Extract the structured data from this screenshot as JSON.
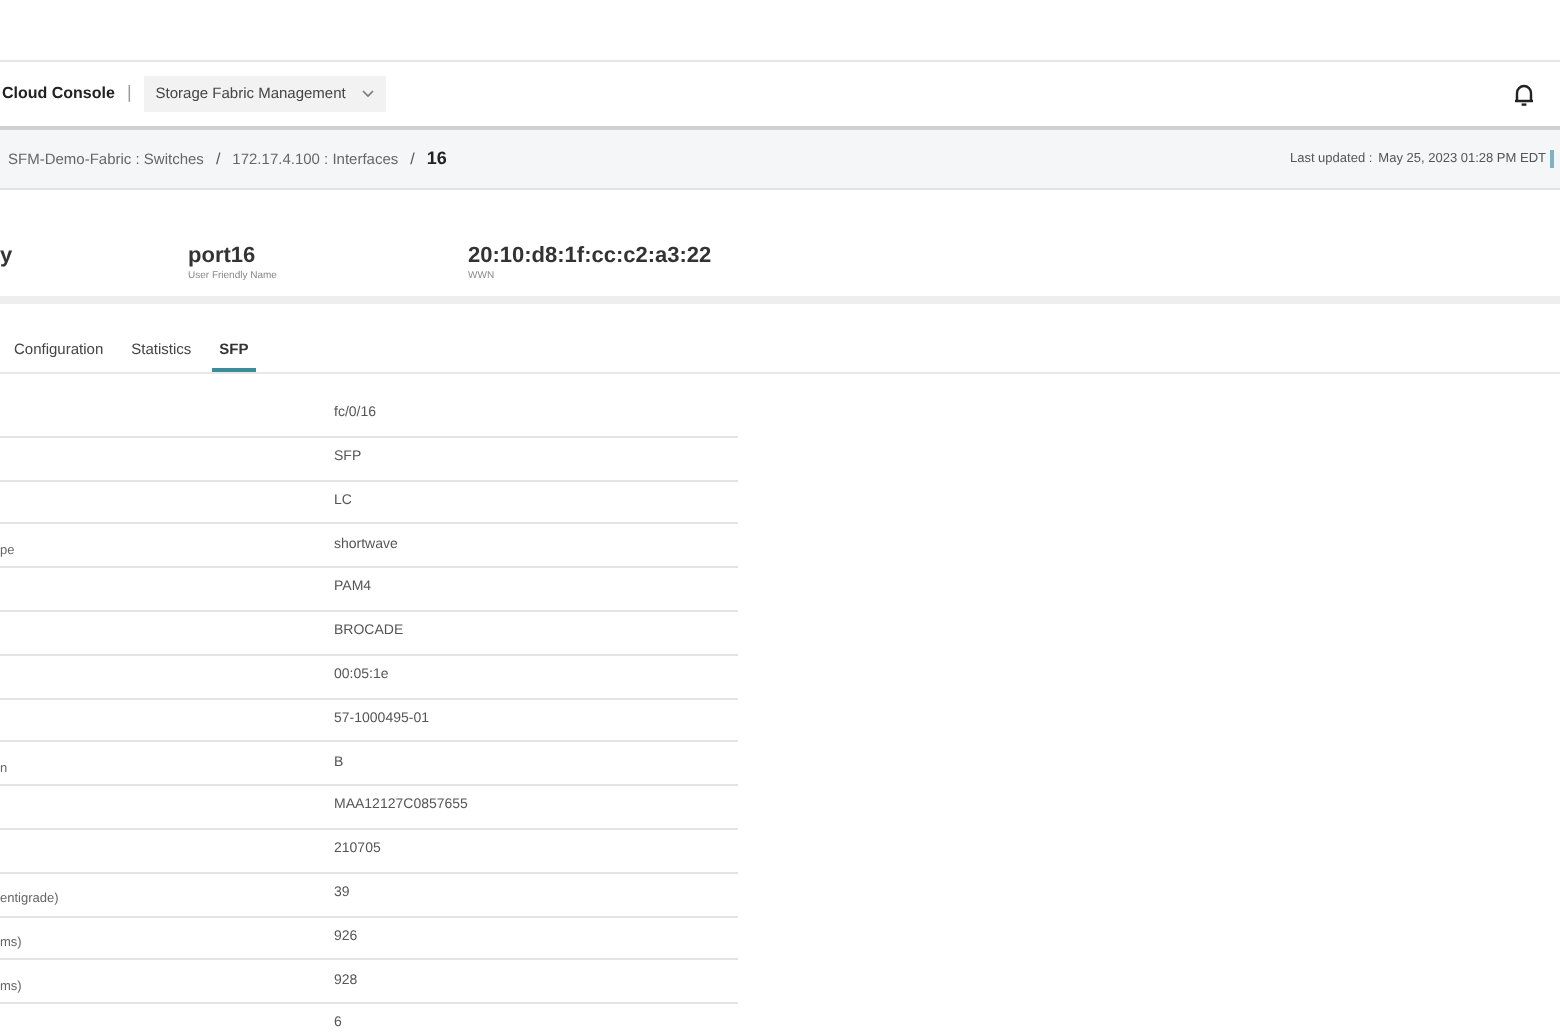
{
  "header": {
    "brand": "Cloud Console",
    "divider": "|",
    "app_selector": "Storage Fabric Management"
  },
  "breadcrumb": {
    "separator": "/",
    "items": [
      {
        "label": "SFM-Demo-Fabric : Switches",
        "current": false
      },
      {
        "label": "172.17.4.100 : Interfaces",
        "current": false
      },
      {
        "label": "16",
        "current": true
      }
    ],
    "last_updated_label": "Last updated :",
    "last_updated": "May 25, 2023 01:28 PM EDT"
  },
  "summary": [
    {
      "value": "y"
    },
    {
      "value": "port16",
      "label": "User Friendly Name"
    },
    {
      "value": "20:10:d8:1f:cc:c2:a3:22",
      "label": "WWN"
    }
  ],
  "tabs": [
    {
      "label": "Configuration",
      "selected": false
    },
    {
      "label": "Statistics",
      "selected": false
    },
    {
      "label": "SFP",
      "selected": true
    }
  ],
  "rows": [
    {
      "value": "fc/0/16"
    },
    {
      "value": "SFP"
    },
    {
      "value": "LC"
    },
    {
      "label": "pe",
      "value": "shortwave"
    },
    {
      "value": "PAM4"
    },
    {
      "value": "BROCADE"
    },
    {
      "value": "00:05:1e"
    },
    {
      "value": "57-1000495-01"
    },
    {
      "label": "n",
      "value": "B"
    },
    {
      "value": "MAA12127C0857655"
    },
    {
      "value": "210705"
    },
    {
      "label": "entigrade)",
      "value": "39"
    },
    {
      "label": "ms)",
      "value": "926"
    },
    {
      "label": "ms)",
      "value": "928"
    },
    {
      "value": "6"
    }
  ]
}
